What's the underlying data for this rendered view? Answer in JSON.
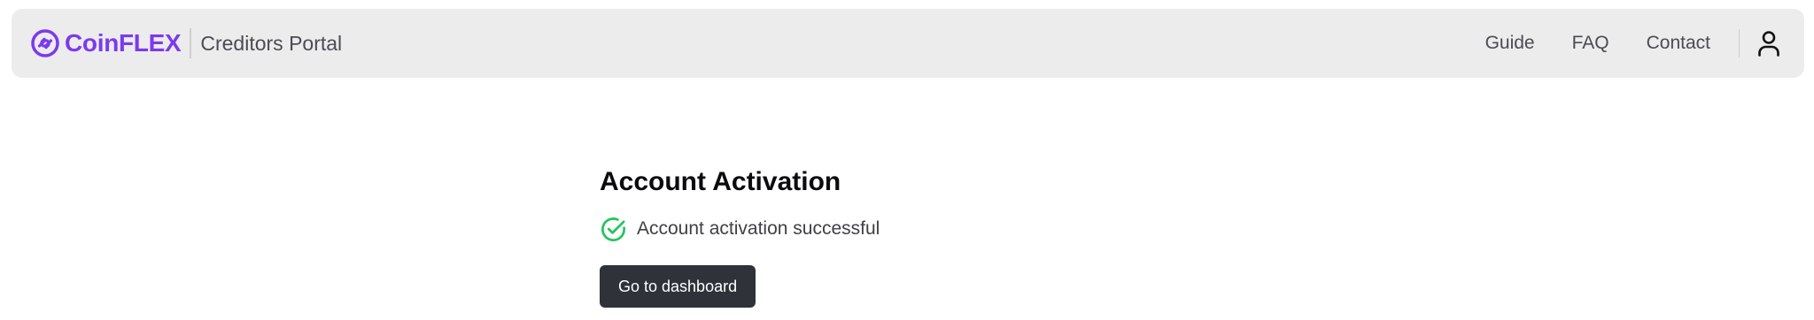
{
  "header": {
    "logo_text": "CoinFLEX",
    "portal_title": "Creditors Portal",
    "nav": {
      "guide": "Guide",
      "faq": "FAQ",
      "contact": "Contact"
    },
    "user_icon": "user-icon",
    "colors": {
      "brand": "#7c3aed",
      "header_bg": "#ececec"
    }
  },
  "main": {
    "title": "Account Activation",
    "status_icon": "check-circle-icon",
    "status_text": "Account activation successful",
    "button_label": "Go to dashboard",
    "colors": {
      "success": "#22c55e",
      "button_bg": "#2f3238"
    }
  }
}
